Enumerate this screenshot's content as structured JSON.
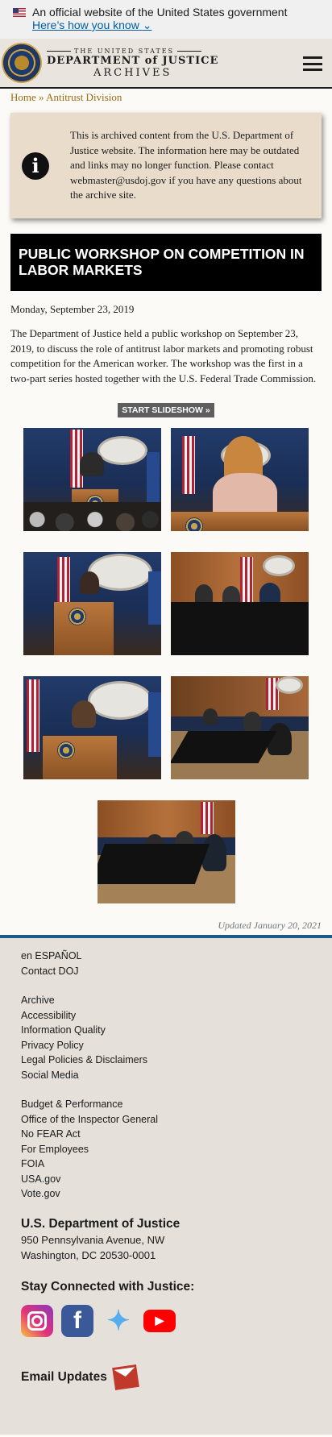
{
  "gov_banner": {
    "text": "An official website of the United States government",
    "link": "Here’s how you know"
  },
  "header": {
    "line1": "THE UNITED STATES",
    "line2": "DEPARTMENT of JUSTICE",
    "line3": "ARCHIVES"
  },
  "breadcrumb": {
    "home": "Home",
    "separator": "»",
    "current": "Antitrust Division"
  },
  "notice": {
    "text": "This is archived content from the U.S. Department of Justice website. The information here may be outdated and links may no longer function. Please contact webmaster@usdoj.gov if you have any questions about the archive site."
  },
  "article": {
    "title": "PUBLIC WORKSHOP ON COMPETITION IN LABOR MARKETS",
    "date": "Monday, September 23, 2019",
    "summary": "The Department of Justice held a public workshop on September 23, 2019, to discuss the role of antitrust labor markets and promoting robust competition for the American worker. The workshop was the first in a two-part series hosted together with the U.S. Federal Trade Commission.",
    "slideshow_label": "START SLIDESHOW »",
    "updated": "Updated January 20, 2021"
  },
  "footer": {
    "group1": [
      "en ESPAÑOL",
      "Contact DOJ"
    ],
    "group2": [
      "Archive",
      "Accessibility",
      "Information Quality",
      "Privacy Policy",
      "Legal Policies & Disclaimers",
      "Social Media"
    ],
    "group3": [
      "Budget & Performance",
      "Office of the Inspector General",
      "No FEAR Act",
      "For Employees",
      "FOIA",
      "USA.gov",
      "Vote.gov"
    ],
    "org_name": "U.S. Department of Justice",
    "address1": "950 Pennsylvania Avenue, NW",
    "address2": "Washington, DC 20530-0001",
    "stay_connected": "Stay Connected with Justice:",
    "email_updates": "Email Updates"
  }
}
